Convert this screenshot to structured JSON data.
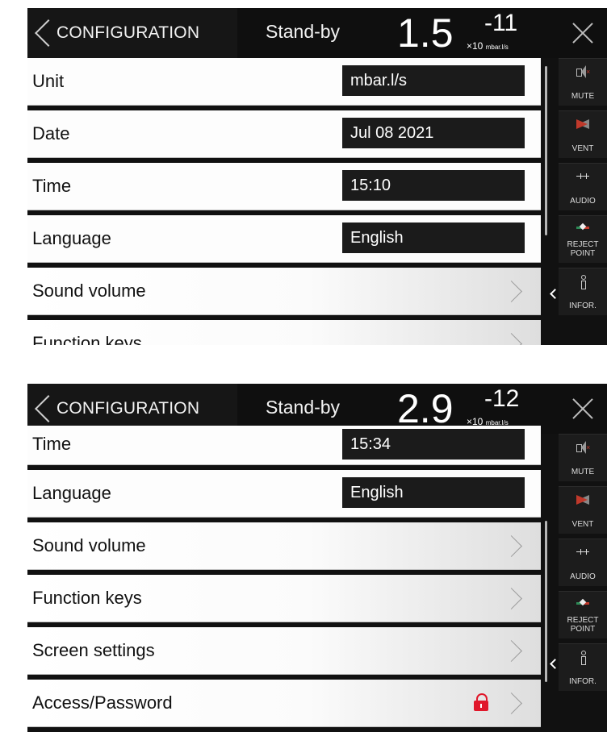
{
  "screens": [
    {
      "header": {
        "back_label": "CONFIGURATION",
        "status": "Stand-by",
        "mantissa": "1.5",
        "exponent": "-11",
        "unit_prefix": "×10",
        "unit": "mbar.l/s"
      },
      "rows": [
        {
          "label": "Unit",
          "value": "mbar.l/s"
        },
        {
          "label": "Date",
          "value": "Jul 08 2021"
        },
        {
          "label": "Time",
          "value": "15:10"
        },
        {
          "label": "Language",
          "value": "English"
        },
        {
          "label": "Sound volume"
        },
        {
          "label": "Function keys"
        }
      ]
    },
    {
      "header": {
        "back_label": "CONFIGURATION",
        "status": "Stand-by",
        "mantissa": "2.9",
        "exponent": "-12",
        "unit_prefix": "×10",
        "unit": "mbar.l/s"
      },
      "rows": [
        {
          "label": "Time",
          "value": "15:34"
        },
        {
          "label": "Language",
          "value": "English"
        },
        {
          "label": "Sound volume"
        },
        {
          "label": "Function keys"
        },
        {
          "label": "Screen settings"
        },
        {
          "label": "Access/Password",
          "icon": "lock-icon"
        }
      ]
    }
  ],
  "sidebar": [
    {
      "label": "MUTE",
      "icon": "mute-icon"
    },
    {
      "label": "VENT",
      "icon": "vent-icon"
    },
    {
      "label": "AUDIO",
      "icon": "audio-icon"
    },
    {
      "label": "REJECT POINT",
      "icon": "reject-point-icon"
    },
    {
      "label": "INFOR.",
      "icon": "info-icon"
    }
  ],
  "colors": {
    "background": "#111111",
    "row": "#fdfdfd",
    "value_box": "#1b1b1b",
    "lock": "#e0172a"
  }
}
